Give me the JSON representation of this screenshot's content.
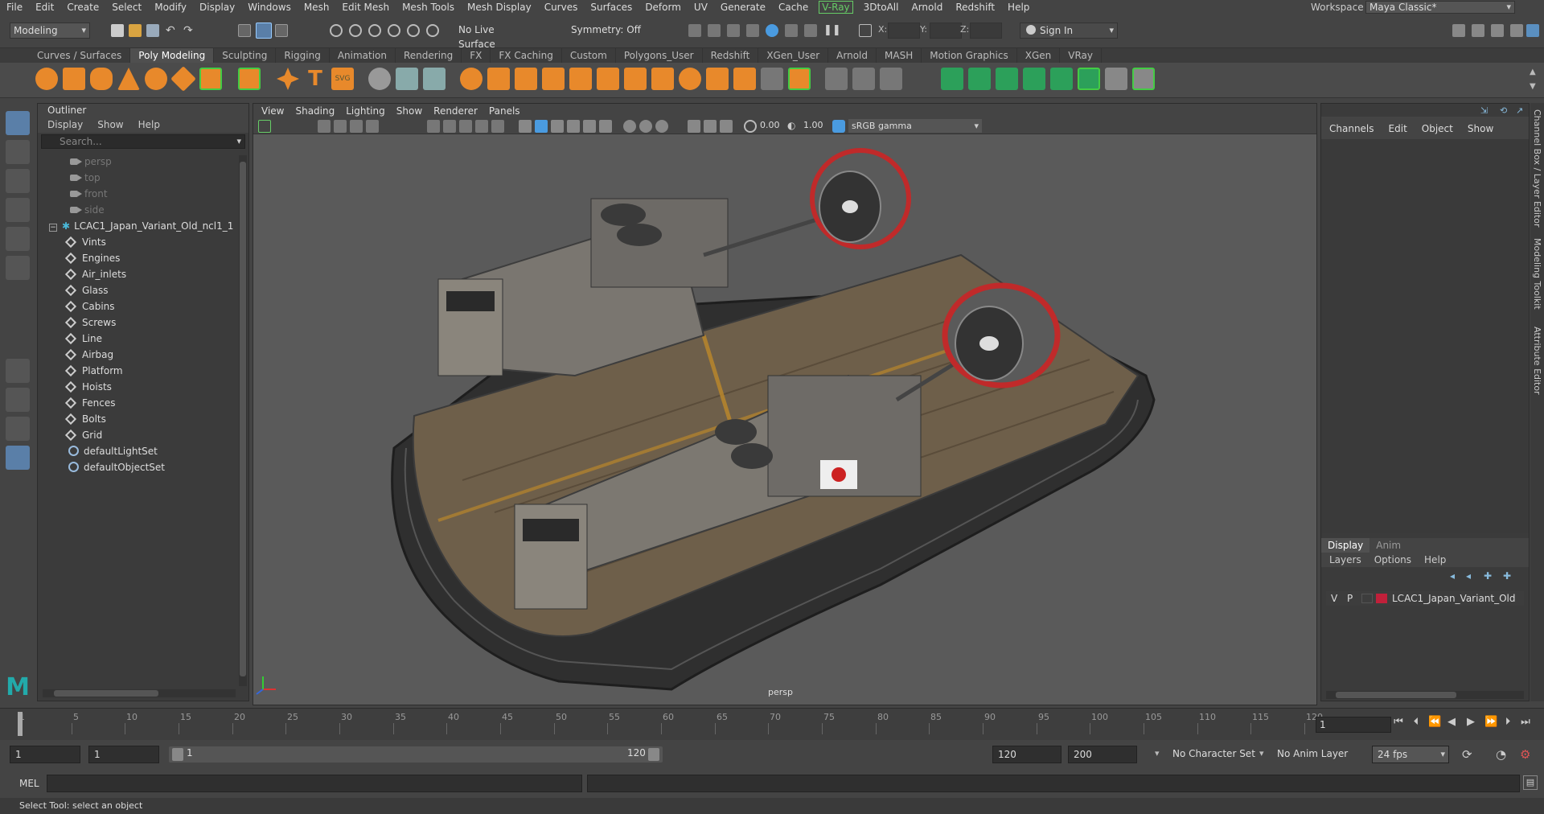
{
  "menubar": {
    "items": [
      "File",
      "Edit",
      "Create",
      "Select",
      "Modify",
      "Display",
      "Windows",
      "Mesh",
      "Edit Mesh",
      "Mesh Tools",
      "Mesh Display",
      "Curves",
      "Surfaces",
      "Deform",
      "UV",
      "Generate",
      "Cache"
    ],
    "vray": "V-Ray",
    "items2": [
      "3DtoAll",
      "Arnold",
      "Redshift",
      "Help"
    ],
    "workspace_label": "Workspace :",
    "workspace_value": "Maya Classic*"
  },
  "statusline": {
    "mode": "Modeling",
    "live_surface": "No Live Surface",
    "symmetry": "Symmetry: Off",
    "x_label": "X:",
    "y_label": "Y:",
    "z_label": "Z:",
    "sign_in": "Sign In"
  },
  "shelf": {
    "tabs": [
      "Curves / Surfaces",
      "Poly Modeling",
      "Sculpting",
      "Rigging",
      "Animation",
      "Rendering",
      "FX",
      "FX Caching",
      "Custom",
      "Polygons_User",
      "Redshift",
      "XGen_User",
      "Arnold",
      "MASH",
      "Motion Graphics",
      "XGen",
      "VRay"
    ],
    "active_tab": "Poly Modeling"
  },
  "outliner": {
    "title": "Outliner",
    "menu": [
      "Display",
      "Show",
      "Help"
    ],
    "search_placeholder": "Search...",
    "cameras": [
      "persp",
      "top",
      "front",
      "side"
    ],
    "root": "LCAC1_Japan_Variant_Old_ncl1_1",
    "children": [
      "Vints",
      "Engines",
      "Air_inlets",
      "Glass",
      "Cabins",
      "Screws",
      "Line",
      "Airbag",
      "Platform",
      "Hoists",
      "Fences",
      "Bolts",
      "Grid"
    ],
    "sets": [
      "defaultLightSet",
      "defaultObjectSet"
    ]
  },
  "viewport": {
    "menu": [
      "View",
      "Shading",
      "Lighting",
      "Show",
      "Renderer",
      "Panels"
    ],
    "exposure": "0.00",
    "gamma": "1.00",
    "color_space": "sRGB gamma",
    "camera_label": "persp"
  },
  "channelbox": {
    "menu": [
      "Channels",
      "Edit",
      "Object",
      "Show"
    ]
  },
  "layer_editor": {
    "tabs": [
      "Display",
      "Anim"
    ],
    "active_tab": "Display",
    "menu": [
      "Layers",
      "Options",
      "Help"
    ],
    "layer": {
      "v": "V",
      "p": "P",
      "name": "LCAC1_Japan_Variant_Old",
      "color": "#c0203a"
    }
  },
  "side_tabs": [
    "Channel Box / Layer Editor",
    "Modeling Toolkit",
    "Attribute Editor"
  ],
  "timeslider": {
    "ticks": [
      "1",
      "5",
      "10",
      "15",
      "20",
      "25",
      "30",
      "35",
      "40",
      "45",
      "50",
      "55",
      "60",
      "65",
      "70",
      "75",
      "80",
      "85",
      "90",
      "95",
      "100",
      "105",
      "110",
      "115",
      "120"
    ],
    "current_frame": "1"
  },
  "range": {
    "start": "1",
    "anim_start": "1",
    "range_start": "1",
    "range_end": "120",
    "end": "120",
    "anim_end": "200",
    "character_set": "No Character Set",
    "anim_layer": "No Anim Layer",
    "fps": "24 fps"
  },
  "cmdline": {
    "label": "MEL"
  },
  "helpline": {
    "text": "Select Tool: select an object"
  }
}
